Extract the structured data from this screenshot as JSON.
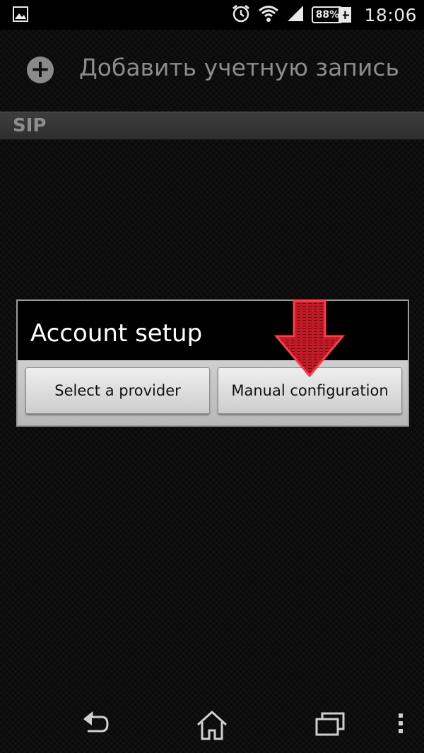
{
  "status_bar": {
    "time": "18:06",
    "battery_percent": "88%",
    "charging_symbol": "+",
    "icons": [
      "image-notification-icon",
      "alarm-icon",
      "wifi-icon",
      "cell-signal-icon",
      "battery-icon"
    ]
  },
  "header": {
    "title": "Добавить учетную запись",
    "icon": "add-circle-icon"
  },
  "section": {
    "label": "SIP"
  },
  "dialog": {
    "title": "Account setup",
    "buttons": {
      "left": "Select a provider",
      "right": "Manual configuration"
    }
  },
  "annotation": {
    "arrow_color": "#d3202a"
  },
  "nav_bar": {
    "icons": [
      "back-icon",
      "home-icon",
      "recent-apps-icon",
      "overflow-menu-icon"
    ]
  },
  "colors": {
    "background": "#0d0d0d",
    "section_header": "#333333",
    "dialog_button_bg": "#dcdcdc"
  }
}
